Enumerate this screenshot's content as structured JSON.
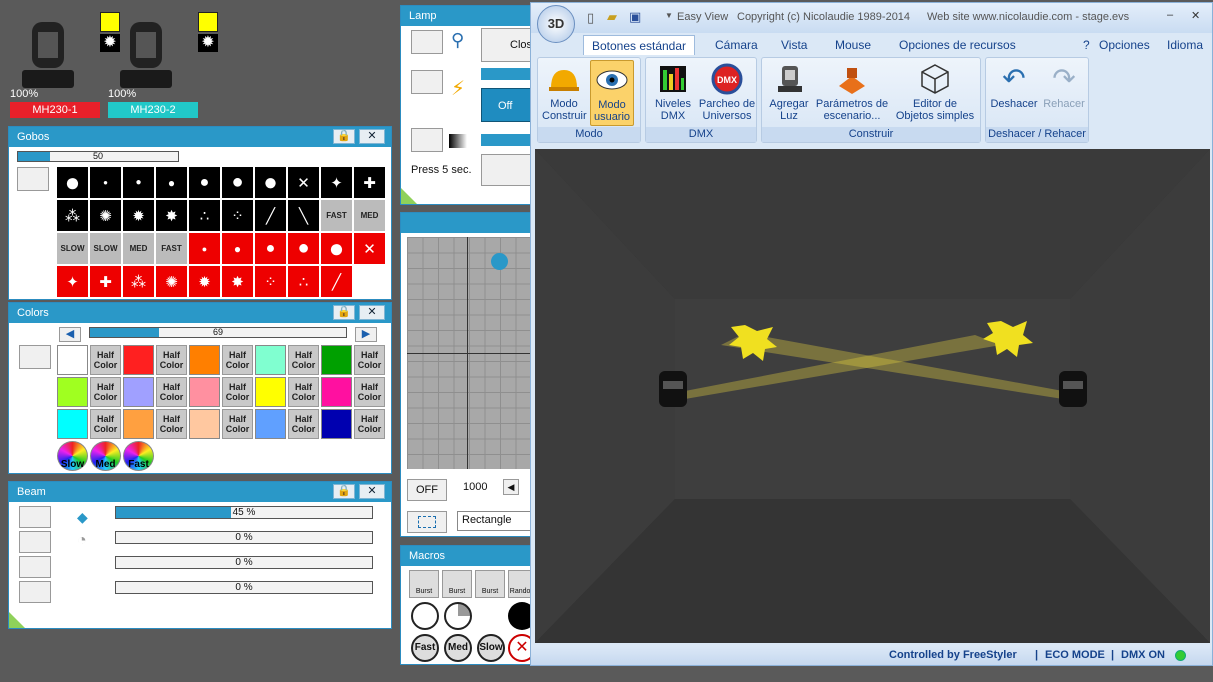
{
  "fixtures": [
    {
      "percent": "100%",
      "name": "MH230-1",
      "name_bg": "#e8202a"
    },
    {
      "percent": "100%",
      "name": "MH230-2",
      "name_bg": "#21c8c8"
    }
  ],
  "gobos": {
    "title": "Gobos",
    "slider_value": "50",
    "slider_fraction": 0.2,
    "speed_labels": [
      "FAST",
      "MED",
      "SLOW",
      "SLOW",
      "MED",
      "FAST"
    ]
  },
  "colors": {
    "title": "Colors",
    "slider_value": "69",
    "slider_fraction": 0.27,
    "half_label_1": "Half",
    "half_label_2": "Color",
    "swatches": [
      "#ffffff",
      "#ff2020",
      "#ff7f00",
      "#80ffd0",
      "#00a000",
      "#a0ff20",
      "#a0a0ff",
      "#ff90a0",
      "#ffff00",
      "#ff10a0",
      "#00ffff",
      "#ffa040",
      "#ffc8a0",
      "#60a0ff",
      "#0000b0"
    ],
    "wheels": [
      "Slow",
      "Med",
      "Fast"
    ]
  },
  "beam": {
    "title": "Beam",
    "rows": [
      {
        "value": "45 %",
        "fraction": 0.45
      },
      {
        "value": "0 %",
        "fraction": 0
      },
      {
        "value": "0 %",
        "fraction": 0
      },
      {
        "value": "0 %",
        "fraction": 0
      }
    ]
  },
  "lamp": {
    "title": "Lamp",
    "close_label": "Clos",
    "off_label": "Off",
    "press_label": "Press 5 sec."
  },
  "pantilt": {
    "off_label": "OFF",
    "value": "1000",
    "shape": "Rectangle"
  },
  "macros": {
    "title": "Macros",
    "labels": [
      "Burst",
      "Burst",
      "Burst",
      "Random"
    ],
    "row3": [
      "Fast",
      "Med",
      "Slow"
    ]
  },
  "easyview": {
    "title": "Easy View",
    "copyright": "Copyright (c) Nicolaudie 1989-2014",
    "website": "Web site www.nicolaudie.com - stage.evs",
    "logo": "3D",
    "tabs": [
      "Botones estándar",
      "Cámara",
      "Vista",
      "Mouse",
      "Opciones de recursos"
    ],
    "right_menu": [
      "?",
      "Opciones",
      "Idioma"
    ],
    "groups": [
      {
        "title": "Modo",
        "buttons": [
          {
            "l1": "Modo",
            "l2": "Construir",
            "icon": "hardhat-icon"
          },
          {
            "l1": "Modo",
            "l2": "usuario",
            "icon": "eye-icon"
          }
        ]
      },
      {
        "title": "DMX",
        "buttons": [
          {
            "l1": "Niveles",
            "l2": "DMX",
            "icon": "levels-icon"
          },
          {
            "l1": "Parcheo de",
            "l2": "Universos",
            "icon": "dmx-icon"
          }
        ]
      },
      {
        "title": "Construir",
        "buttons": [
          {
            "l1": "Agregar",
            "l2": "Luz",
            "icon": "light-icon"
          },
          {
            "l1": "Parámetros de",
            "l2": "escenario...",
            "icon": "stage-icon"
          },
          {
            "l1": "Editor de",
            "l2": "Objetos simples",
            "icon": "cube-icon"
          }
        ]
      },
      {
        "title": "Deshacer / Rehacer",
        "buttons": [
          {
            "l1": "Deshacer",
            "l2": "",
            "icon": "undo-icon"
          },
          {
            "l1": "Rehacer",
            "l2": "",
            "icon": "redo-icon"
          }
        ]
      }
    ],
    "status": [
      "Controlled by FreeStyler",
      "ECO MODE",
      "DMX ON"
    ]
  }
}
